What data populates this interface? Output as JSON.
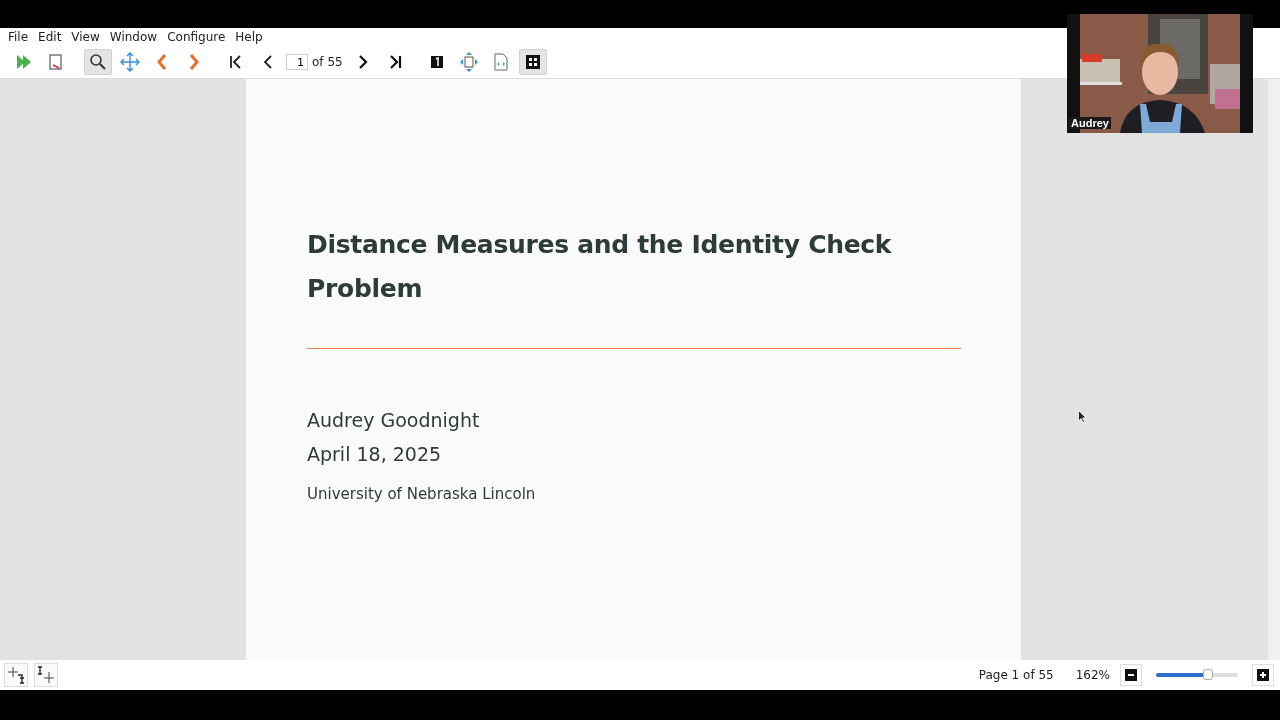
{
  "menu": [
    {
      "label": "File"
    },
    {
      "label": "Edit"
    },
    {
      "label": "View"
    },
    {
      "label": "Window"
    },
    {
      "label": "Configure"
    },
    {
      "label": "Help"
    }
  ],
  "toolbar": [
    {
      "kind": "play",
      "selected": false
    },
    {
      "kind": "reload",
      "selected": false
    },
    {
      "kind": "zoom",
      "selected": true
    },
    {
      "kind": "pan",
      "selected": false
    },
    {
      "kind": "back",
      "selected": false
    },
    {
      "kind": "forward",
      "selected": false
    },
    {
      "kind": "first",
      "selected": false
    },
    {
      "kind": "prev",
      "selected": false
    },
    {
      "kind": "pagefield",
      "value": "1",
      "total": "of 55"
    },
    {
      "kind": "next",
      "selected": false
    },
    {
      "kind": "last",
      "selected": false
    },
    {
      "kind": "single",
      "selected": false
    },
    {
      "kind": "fit",
      "selected": false
    },
    {
      "kind": "fitwidth",
      "selected": false
    },
    {
      "kind": "grid",
      "selected": true
    }
  ],
  "slide": {
    "title": "Distance Measures and the Identity Check Problem",
    "author": "Audrey Goodnight",
    "date": "April 18, 2025",
    "institution": "University of Nebraska Lincoln"
  },
  "video": {
    "kind": "picture",
    "name": "Audrey"
  },
  "status_bar": {
    "page": "Page 1 of 55",
    "zoom": "162%",
    "zoom_slider": {
      "level": 0.63
    }
  }
}
